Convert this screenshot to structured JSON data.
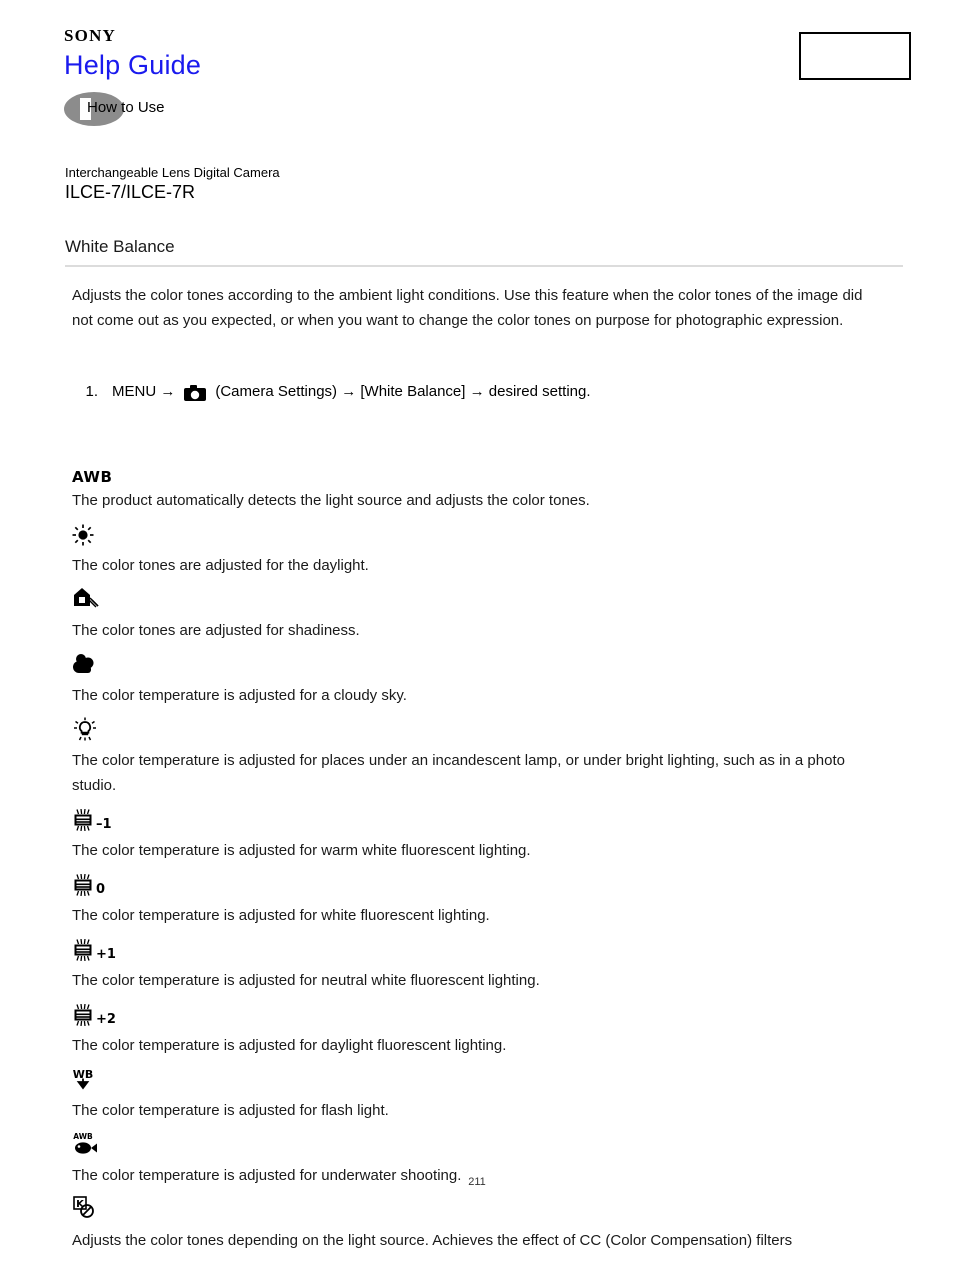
{
  "header": {
    "brand": "SONY",
    "site_title": "Help Guide",
    "how_to_use_label": "How to Use",
    "badge_icon": "book-icon",
    "top_right_box": "",
    "title_color": "#1a1aee",
    "badge_color": "#8c8c8c"
  },
  "product": {
    "category": "Interchangeable Lens Digital Camera",
    "model": "ILCE-7/ILCE-7R"
  },
  "article": {
    "title": "White Balance",
    "intro": "Adjusts the color tones according to the ambient light conditions. Use this feature when the color tones of the image did not come out as you expected, or when you want to change the color tones on purpose for photographic expression.",
    "steps": [
      {
        "number": "1.",
        "before_icon": "MENU →",
        "icon": "camera-icon",
        "after_icon": "(Camera Settings) → [White Balance] → desired setting."
      }
    ],
    "options": [
      {
        "icon": "awb-text-icon",
        "icon_label": "AWB",
        "suffix": "",
        "description": "The product automatically detects the light source and adjusts the color tones."
      },
      {
        "icon": "daylight-sun-icon",
        "icon_label": "",
        "suffix": "",
        "description": "The color tones are adjusted for the daylight."
      },
      {
        "icon": "shade-house-icon",
        "icon_label": "",
        "suffix": "",
        "description": "The color tones are adjusted for shadiness."
      },
      {
        "icon": "cloudy-icon",
        "icon_label": "",
        "suffix": "",
        "description": "The color temperature is adjusted for a cloudy sky."
      },
      {
        "icon": "incandescent-lamp-icon",
        "icon_label": "",
        "suffix": "",
        "description": "The color temperature is adjusted for places under an incandescent lamp, or under bright lighting, such as in a photo studio."
      },
      {
        "icon": "fluorescent-icon",
        "icon_label": "",
        "suffix": "–1",
        "description": "The color temperature is adjusted for warm white fluorescent lighting."
      },
      {
        "icon": "fluorescent-icon",
        "icon_label": "",
        "suffix": "0",
        "description": "The color temperature is adjusted for white fluorescent lighting."
      },
      {
        "icon": "fluorescent-icon",
        "icon_label": "",
        "suffix": "+1",
        "description": "The color temperature is adjusted for neutral white fluorescent lighting."
      },
      {
        "icon": "fluorescent-icon",
        "icon_label": "",
        "suffix": "+2",
        "description": "The color temperature is adjusted for daylight fluorescent lighting."
      },
      {
        "icon": "flash-wb-icon",
        "icon_label": "WB",
        "suffix": "",
        "description": "The color temperature is adjusted for flash light."
      },
      {
        "icon": "underwater-fish-icon",
        "icon_label": "AWB",
        "suffix": "",
        "description": "The color temperature is adjusted for underwater shooting."
      },
      {
        "icon": "color-temp-filter-icon",
        "icon_label": "K",
        "suffix": "",
        "description": "Adjusts the color tones depending on the light source. Achieves the effect of CC (Color Compensation) filters"
      }
    ]
  },
  "footer": {
    "page_number": "211"
  }
}
